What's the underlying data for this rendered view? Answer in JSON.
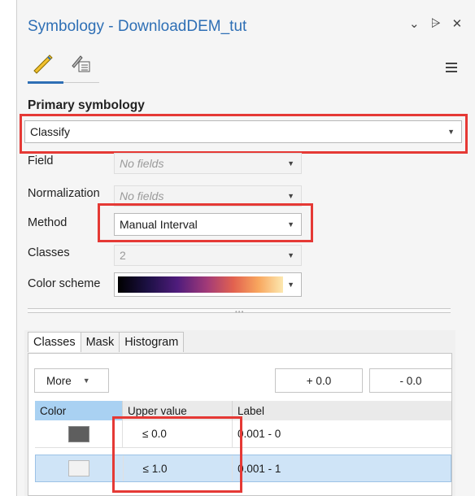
{
  "window": {
    "title": "Symbology - DownloadDEM_tut",
    "icons": [
      "chevron-down-icon",
      "pin-icon",
      "close-icon"
    ]
  },
  "section_title": "Primary symbology",
  "primary_dropdown": {
    "value": "Classify"
  },
  "fields": {
    "field": {
      "label": "Field",
      "value": "No fields"
    },
    "normalization": {
      "label": "Normalization",
      "value": "No fields"
    },
    "method": {
      "label": "Method",
      "value": "Manual Interval"
    },
    "classes": {
      "label": "Classes",
      "value": "2"
    },
    "color_scheme": {
      "label": "Color scheme",
      "colors": [
        "#000000",
        "#4f1c7c",
        "#a23a78",
        "#e2624f",
        "#f8a65e",
        "#fce8b0"
      ]
    }
  },
  "tabs": [
    {
      "label": "Classes"
    },
    {
      "label": "Mask"
    },
    {
      "label": "Histogram"
    }
  ],
  "toolbar": {
    "more_label": "More",
    "plus_label": "+ 0.0",
    "minus_label": "- 0.0"
  },
  "table": {
    "headers": [
      "Color",
      "Upper value",
      "Label"
    ],
    "rows": [
      {
        "color": "#5e5e5e",
        "upper": "≤  0.0",
        "label": "0.001 - 0"
      },
      {
        "color": "#f2f2f2",
        "upper": "≤  1.0",
        "label": "0.001 - 1"
      }
    ]
  },
  "accent_color": "#2e6fb5",
  "highlight_color": "#e53935"
}
